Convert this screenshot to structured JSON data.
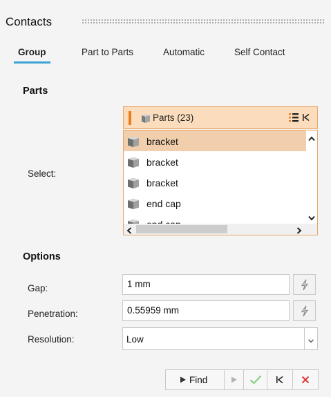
{
  "panel": {
    "title": "Contacts"
  },
  "tabs": [
    {
      "label": "Group",
      "active": true
    },
    {
      "label": "Part to Parts",
      "active": false
    },
    {
      "label": "Automatic",
      "active": false
    },
    {
      "label": "Self Contact",
      "active": false
    }
  ],
  "parts": {
    "section_label": "Parts",
    "select_label": "Select:",
    "header_label": "Parts (23)",
    "items": [
      {
        "label": "bracket",
        "selected": true
      },
      {
        "label": "bracket",
        "selected": false
      },
      {
        "label": "bracket",
        "selected": false
      },
      {
        "label": "end cap",
        "selected": false
      },
      {
        "label": "end cap",
        "selected": false
      }
    ]
  },
  "options": {
    "section_label": "Options",
    "gap_label": "Gap:",
    "gap_value": "1 mm",
    "penetration_label": "Penetration:",
    "penetration_value": "0.55959 mm",
    "resolution_label": "Resolution:",
    "resolution_value": "Low"
  },
  "toolbar": {
    "find_label": "Find"
  },
  "colors": {
    "accent_tab": "#3aa3d6",
    "selection_orange": "#e87f1c",
    "header_fill": "#fbdcbc",
    "selected_row": "#f1cfac",
    "ok_green": "#7fcf7a",
    "cancel_red": "#e03a3a"
  }
}
